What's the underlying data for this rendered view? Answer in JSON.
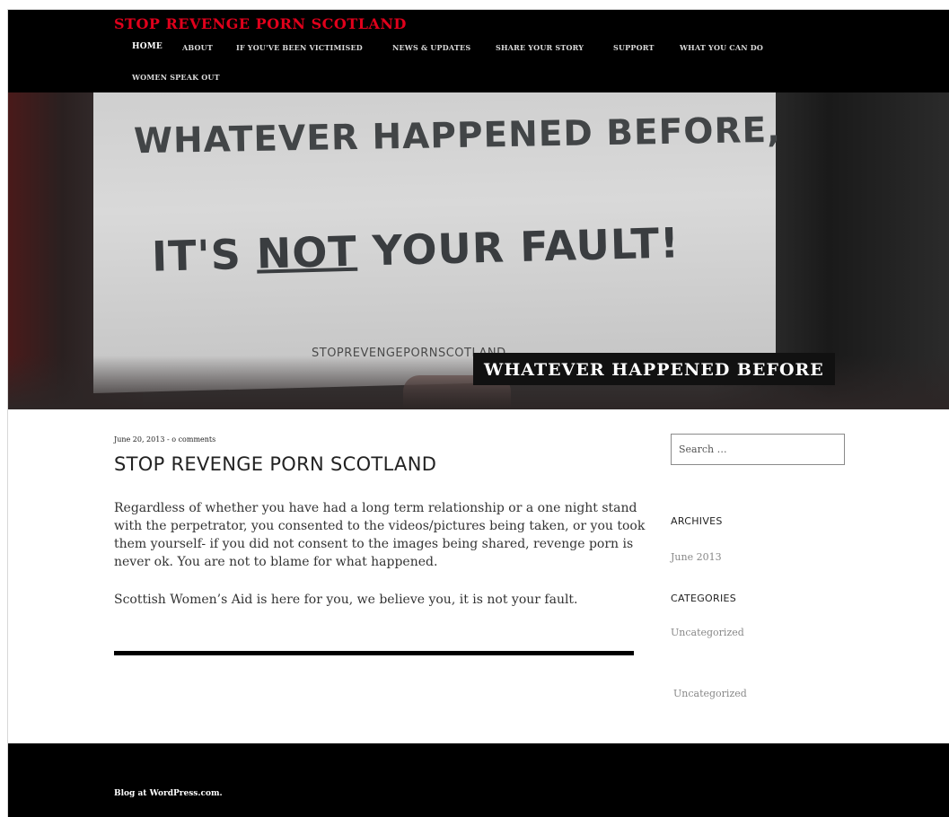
{
  "site": {
    "title": "STOP REVENGE PORN SCOTLAND"
  },
  "nav": {
    "items": [
      {
        "label": "HOME",
        "active": true
      },
      {
        "label": "ABOUT"
      },
      {
        "label": "IF YOU'VE BEEN VICTIMISED"
      },
      {
        "label": "NEWS & UPDATES"
      },
      {
        "label": "SHARE YOUR STORY"
      },
      {
        "label": "SUPPORT"
      },
      {
        "label": "WHAT YOU CAN DO"
      },
      {
        "label": "WOMEN SPEAK OUT"
      }
    ]
  },
  "hero": {
    "sign_line1": "WHATEVER HAPPENED BEFORE,",
    "sign_line2_pre": "IT'S ",
    "sign_line2_underlined": "NOT",
    "sign_line2_post": " YOUR FAULT!",
    "sign_url": "STOPREVENGEPORNSCOTLAND",
    "caption": "WHATEVER HAPPENED BEFORE"
  },
  "post": {
    "meta": "June 20, 2013 - o comments",
    "title": "STOP REVENGE PORN SCOTLAND",
    "paragraphs": [
      "Regardless of whether you have had a long term relationship or a one night stand with the perpetrator, you consented to the videos/pictures being taken, or you took them yourself- if you did not consent to the images being shared, revenge porn is never ok. You are not to blame for what happened.",
      "Scottish Women’s Aid is here for you, we believe you, it is not your fault."
    ]
  },
  "sidebar": {
    "search_placeholder": "Search …",
    "archives_title": "ARCHIVES",
    "archives_link": "June 2013",
    "categories_title": "CATEGORIES",
    "categories_link": "Uncategorized",
    "extra_link": "Uncategorized"
  },
  "footer": {
    "text": "Blog at WordPress.com."
  },
  "colors": {
    "site_title": "#e0001b",
    "header_bg": "#000000",
    "link_gray": "#888888"
  }
}
